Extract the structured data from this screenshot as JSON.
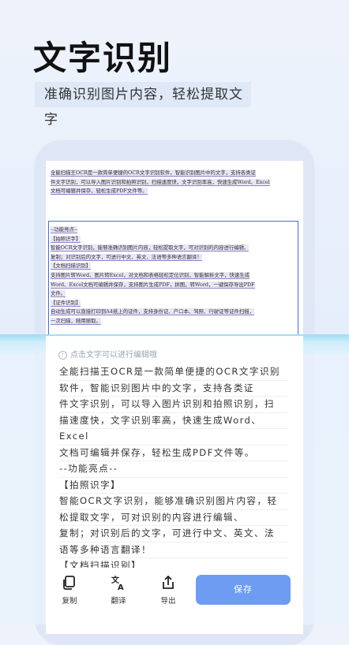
{
  "hero": {
    "title": "文字识别",
    "subtitle": "准确识别图片内容，轻松提取文字"
  },
  "document": {
    "para1": [
      "全能扫描王OCR是一款简单便捷的OCR文字识别软件，智能识别图片中的文字，支持各类证",
      "件文字识别，可以导入图片识别和拍照识别，扫描速度快，文字识别率高，快速生成Word、Excel",
      "文档可编辑并保存，轻松生成PDF文件等。"
    ],
    "para2": [
      "--功能亮点--",
      "【拍照识字】",
      "智能OCR文字识别，能够准确识别图片内容，轻松提取文字，可对识别的内容进行编辑、",
      "复制；对识别后的文字，可进行中文、英文、法语等多种语言翻译！",
      "【文档扫描识别】",
      "支持图片转Word、图片转Excel，对文档和表格轻松定位识别，智能解析文字，快速生成",
      "Word、Excel文档可编辑并保存，支持图片生成PDF，拼图，转Word，一键保存导出PDF",
      "文件。",
      "【证件识别】",
      "自动生成可以直接打印到A4纸上的证件，支持身份证、户口本、驾照、行驶证等证件扫描，",
      "一次扫描，随用随取。"
    ]
  },
  "editor": {
    "hint": "点击文字可以进行编辑哦",
    "lines": [
      "全能扫描王OCR是一款简单便捷的OCR文字识别",
      "软件，智能识别图片中的文字，支持各类证",
      "件文字识别，可以导入图片识别和拍照识别，扫",
      "描速度快，文字识别率高，快速生成Word、",
      "Excel",
      "文档可编辑并保存，轻松生成PDF文件等。",
      "--功能亮点--",
      "【拍照识字】",
      "智能OCR文字识别，能够准确识别图片内容，轻",
      "松提取文字，可对识别的内容进行编辑、",
      "复制；对识别后的文字，可进行中文、英文、法",
      "语等多种语言翻译！",
      "【文档扫描识别】"
    ]
  },
  "toolbar": {
    "copy_label": "复制",
    "translate_label": "翻译",
    "export_label": "导出",
    "save_label": "保存"
  },
  "colors": {
    "accent": "#6d9cf2",
    "selection": "#3f6fe0",
    "scan_glow": "#9fdcf3"
  }
}
